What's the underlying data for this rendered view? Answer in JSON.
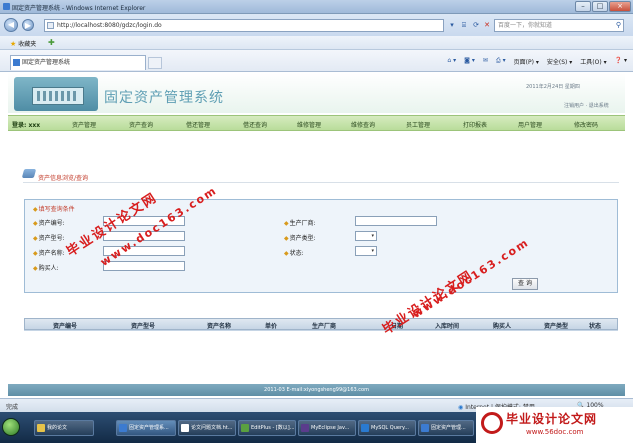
{
  "browser": {
    "window_title": "固定资产管理系统 - Windows Internet Explorer",
    "address_url": "http://localhost:8080/gdzc/login.do",
    "search_placeholder": "百度一下，你就知道",
    "favorites_label": "收藏夹",
    "tab_title": "固定资产管理系统",
    "cmd_items": [
      "页面(P) ▾",
      "安全(S) ▾",
      "工具(O) ▾",
      "❓ ▾"
    ],
    "status_text": "完成",
    "zone_text": "Internet | 保护模式: 禁用",
    "zoom_text": "100%"
  },
  "header": {
    "system_title": "固定资产管理系统",
    "date": "2011年2月24日   星期四",
    "user_links": "注销用户 · 退出系统"
  },
  "nav": {
    "user": "登录: xxx",
    "items": [
      "资产管理",
      "资产查询",
      "借还管理",
      "借还查询",
      "维修管理",
      "维修查询",
      "员工管理",
      "打印报表",
      "用户管理",
      "修改密码"
    ]
  },
  "breadcrumb": "资产信息浏览/查询",
  "query": {
    "legend": "填写查询条件",
    "left_labels": [
      "资产编号:",
      "资产型号:",
      "资产名称:",
      "购买人:"
    ],
    "right_labels": [
      "生产厂商:",
      "资产类型:",
      "状态:"
    ],
    "search_button": "查  询"
  },
  "table": {
    "headers": [
      "资产编号",
      "资产型号",
      "资产名称",
      "单价",
      "生产厂商",
      "日期",
      "入库时间",
      "购买人",
      "资产类型",
      "状态"
    ]
  },
  "footer": "2011-03 E-mail:xiyongsheng99@163.com",
  "taskbar": {
    "items": [
      "我的论文",
      "固定资产管理系...",
      "论文问题文档.ht...",
      "EditPlus - [数以]...",
      "MyEclipse Jav...",
      "MySQL Query...",
      "固定资产管理..."
    ]
  },
  "watermarks": {
    "cn": "毕业设计论文网",
    "en": "www.doc163.com"
  },
  "corner_logo": {
    "cn": "毕业设计论文网",
    "en": "www.56doc.com"
  }
}
